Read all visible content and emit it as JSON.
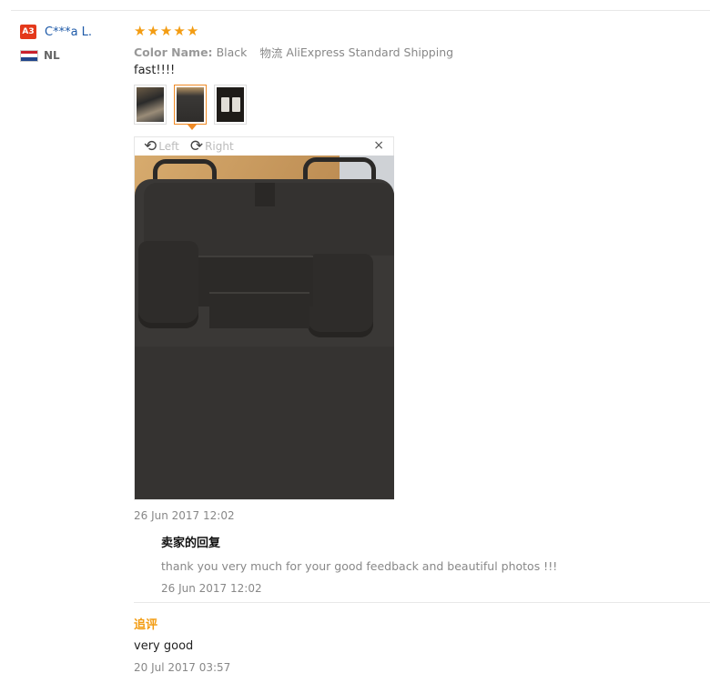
{
  "review": {
    "user": {
      "level_badge": "A3",
      "name": "C***a L.",
      "country_code": "NL"
    },
    "rating": 5,
    "stars": [
      "★",
      "★",
      "★",
      "★",
      "★"
    ],
    "color_label": "Color Name:",
    "color_value": "Black",
    "shipping_label": "物流",
    "shipping_value": "AliExpress Standard Shipping",
    "text": "fast!!!!",
    "viewer": {
      "left_label": "Left",
      "right_label": "Right",
      "close_label": "×",
      "rotate_left_icon": "⟲",
      "rotate_right_icon": "⟳"
    },
    "date": "26 Jun 2017 12:02",
    "seller_reply": {
      "title": "卖家的回复",
      "text": "thank you very much for your good feedback and beautiful photos !!!",
      "date": "26 Jun 2017 12:02"
    },
    "followup": {
      "label": "追评",
      "text": "very good",
      "date": "20 Jul 2017 03:57"
    }
  },
  "colors": {
    "star": "#f39c12",
    "user_name": "#1e5aa8",
    "badge": "#e4391b",
    "active_thumb": "#f08a24",
    "followup_label": "#f39c12"
  },
  "icons": {
    "star": "star-icon",
    "flag": "netherlands-flag-icon",
    "rotate_left": "rotate-left-icon",
    "rotate_right": "rotate-right-icon",
    "close": "close-icon"
  }
}
